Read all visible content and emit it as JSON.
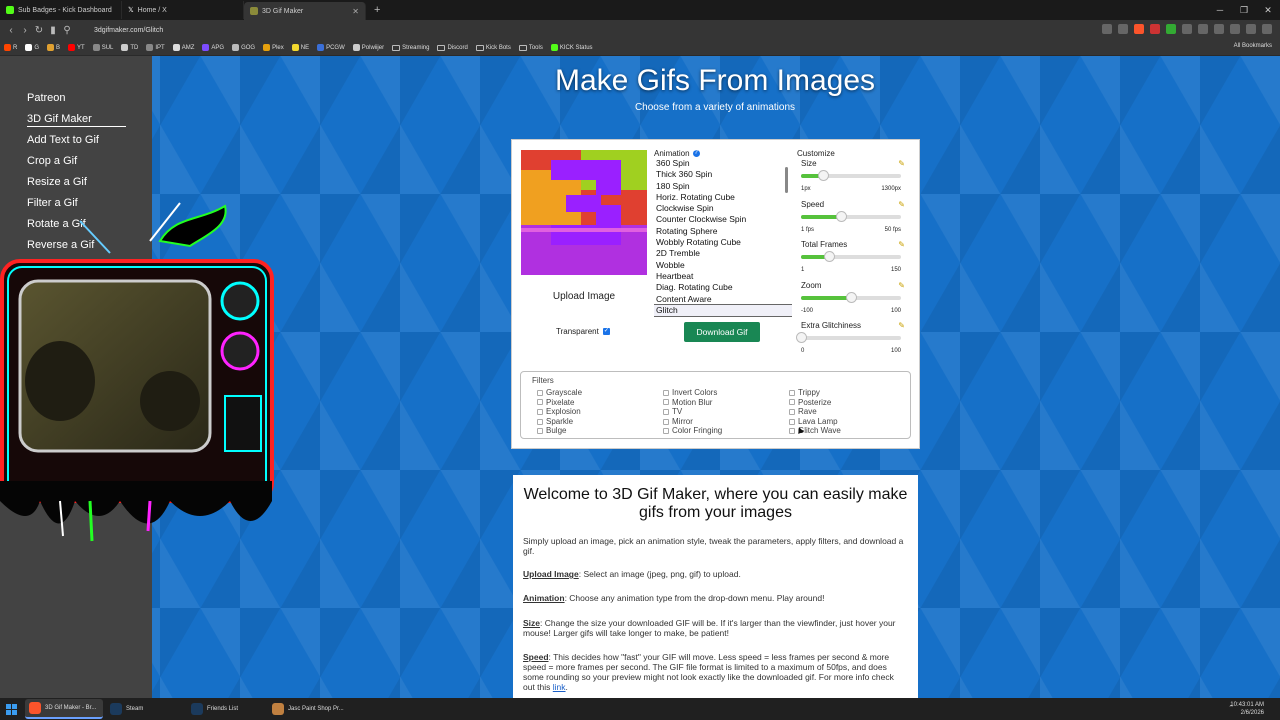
{
  "browser": {
    "tabs": [
      {
        "label": "Sub Badges - Kick Dashboard",
        "color": "#53fc18",
        "active": false
      },
      {
        "label": "Home / X",
        "color": "#ffffff",
        "active": false
      },
      {
        "label": "3D Gif Maker",
        "color": "#8b8b3a",
        "active": true
      }
    ],
    "new_tab": "+",
    "url": "3dgifmaker.com/Glitch",
    "bookmarks": [
      {
        "label": "R",
        "icon": "reddit-icon",
        "color": "#ff4500"
      },
      {
        "label": "G",
        "icon": "google-icon",
        "color": "#ffffff"
      },
      {
        "label": "B",
        "icon": "b-icon",
        "color": "#e0a030"
      },
      {
        "label": "YT",
        "icon": "youtube-icon",
        "color": "#ff0000"
      },
      {
        "label": "SUL",
        "icon": "sul-icon",
        "color": "#888888"
      },
      {
        "label": "TD",
        "icon": "td-icon",
        "color": "#cccccc"
      },
      {
        "label": "IPT",
        "icon": "ipt-icon",
        "color": "#888888"
      },
      {
        "label": "AMZ",
        "icon": "amazon-icon",
        "color": "#dddddd"
      },
      {
        "label": "APG",
        "icon": "apg-icon",
        "color": "#7d4cff"
      },
      {
        "label": "GOG",
        "icon": "gog-icon",
        "color": "#bbbbbb"
      },
      {
        "label": "Plex",
        "icon": "plex-icon",
        "color": "#e5a00d"
      },
      {
        "label": "NE",
        "icon": "ne-icon",
        "color": "#f2d82e"
      },
      {
        "label": "PCGW",
        "icon": "pcgw-icon",
        "color": "#3a6fd8"
      },
      {
        "label": "Polwiijer",
        "icon": "polwiijer-icon",
        "color": "#cccccc"
      },
      {
        "label": "Streaming",
        "icon": "folder-icon",
        "color": ""
      },
      {
        "label": "Discord",
        "icon": "folder-icon",
        "color": ""
      },
      {
        "label": "Kick Bots",
        "icon": "folder-icon",
        "color": ""
      },
      {
        "label": "Tools",
        "icon": "folder-icon",
        "color": ""
      },
      {
        "label": "KICK Status",
        "icon": "kick-icon",
        "color": "#53fc18"
      }
    ],
    "all_bookmarks": "All Bookmarks"
  },
  "sidebar": {
    "items": [
      "Patreon",
      "3D Gif Maker",
      "Add Text to Gif",
      "Crop a Gif",
      "Resize a Gif",
      "Filter a Gif",
      "Rotate a Gif",
      "Reverse a Gif"
    ]
  },
  "hero": {
    "title": "Make Gifs From Images",
    "subtitle": "Choose from a variety of animations"
  },
  "editor": {
    "upload_label": "Upload Image",
    "transparent_label": "Transparent",
    "transparent_checked": true,
    "animation_label": "Animation",
    "animations": [
      "360 Spin",
      "Thick 360 Spin",
      "180 Spin",
      "Horiz. Rotating Cube",
      "Clockwise Spin",
      "Counter Clockwise Spin",
      "Rotating Sphere",
      "Wobbly Rotating Cube",
      "2D Tremble",
      "Wobble",
      "Heartbeat",
      "Diag. Rotating Cube",
      "Content Aware",
      "Glitch"
    ],
    "selected_animation": "Glitch",
    "download_label": "Download Gif",
    "customize_label": "Customize",
    "sliders": [
      {
        "label": "Size",
        "min": "1px",
        "max": "1300px",
        "level": 0.22
      },
      {
        "label": "Speed",
        "min": "1 fps",
        "max": "50 fps",
        "level": 0.4
      },
      {
        "label": "Total Frames",
        "min": "1",
        "max": "150",
        "level": 0.28
      },
      {
        "label": "Zoom",
        "min": "-100",
        "max": "100",
        "level": 0.5
      },
      {
        "label": "Extra Glitchiness",
        "min": "0",
        "max": "100",
        "level": 0.0
      }
    ],
    "filters_label": "Filters",
    "filters": [
      [
        "Grayscale",
        "Pixelate",
        "Explosion",
        "Sparkle",
        "Bulge"
      ],
      [
        "Invert Colors",
        "Motion Blur",
        "TV",
        "Mirror",
        "Color Fringing"
      ],
      [
        "Trippy",
        "Posterize",
        "Rave",
        "Lava Lamp",
        "Glitch Wave"
      ]
    ]
  },
  "welcome": {
    "title": "Welcome to 3D Gif Maker, where you can easily make gifs from your images",
    "intro": "Simply upload an image, pick an animation style, tweak the parameters, apply filters, and download a gif.",
    "upload_term": "Upload Image",
    "upload_desc": ": Select an image (jpeg, png, gif) to upload.",
    "animation_term": "Animation",
    "animation_desc": ": Choose any animation type from the drop-down menu. Play around!",
    "size_term": "Size",
    "size_desc": ": Change the size your downloaded GIF will be. If it's larger than the viewfinder, just hover your mouse! Larger gifs will take longer to make, be patient!",
    "speed_term": "Speed",
    "speed_desc": ": This decides how \"fast\" your GIF will move. Less speed = less frames per second & more speed = more frames per second. The GIF file format is limited to a maximum of 50fps, and does some rounding so your preview might not look exactly like the downloaded gif. For more info check out this ",
    "speed_link": "link",
    "speed_end": "."
  },
  "taskbar": {
    "apps": [
      {
        "label": "3D Gif Maker - Br...",
        "icon": "brave-icon",
        "color": "#fb542b",
        "active": true
      },
      {
        "label": "Steam",
        "icon": "steam-icon",
        "color": "#1b3a5c",
        "active": false
      },
      {
        "label": "Friends List",
        "icon": "steam-friends-icon",
        "color": "#1b3a5c",
        "active": false
      },
      {
        "label": "Jasc Paint Shop Pr...",
        "icon": "paint-shop-icon",
        "color": "#c08040",
        "active": false
      }
    ],
    "time": "10:43:01 AM",
    "date": "2/6/2026"
  }
}
